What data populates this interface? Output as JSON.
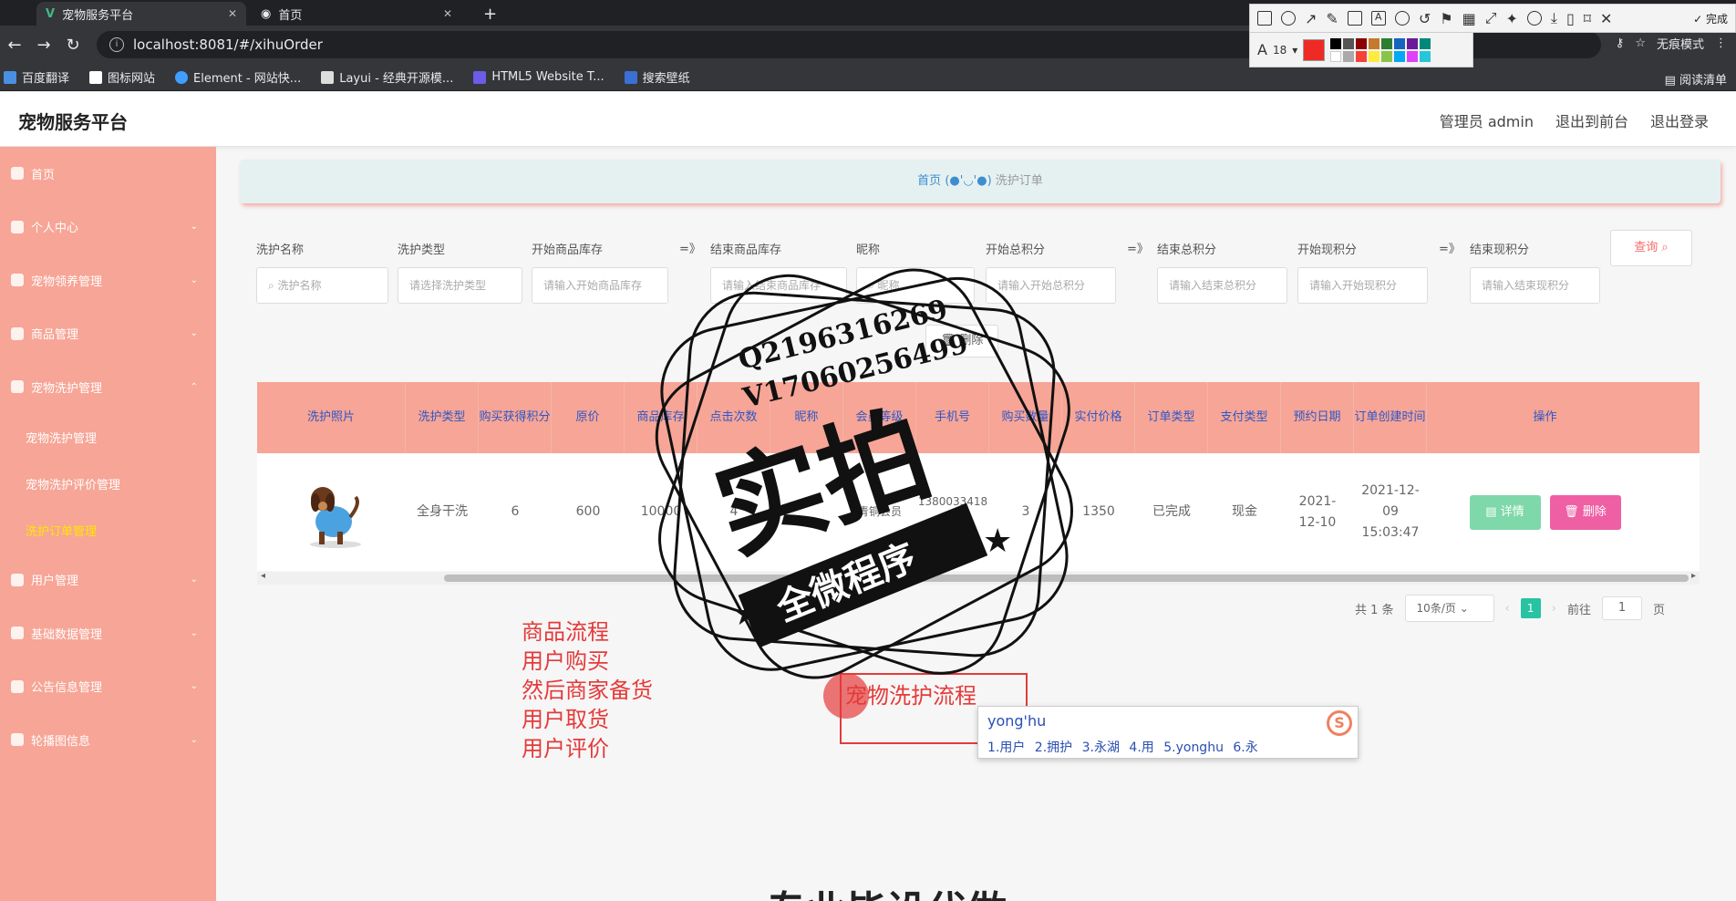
{
  "browser": {
    "tabs": [
      {
        "title": "宠物服务平台",
        "active": true
      },
      {
        "title": "首页",
        "active": false
      }
    ],
    "url": "localhost:8081/#/xihuOrder",
    "bookmarks": [
      "百度翻译",
      "图标网站",
      "Element - 网站快...",
      "Layui - 经典开源模...",
      "HTML5 Website T...",
      "搜索壁纸"
    ],
    "reading_list": "阅读清单",
    "profile": "无痕模式"
  },
  "annotation_toolbar": {
    "done_label": "完成",
    "font_size": "18",
    "active_color": "#ee2a24"
  },
  "header": {
    "title": "宠物服务平台",
    "links": [
      "管理员 admin",
      "退出到前台",
      "退出登录"
    ]
  },
  "sidebar": {
    "items": [
      {
        "label": "首页"
      },
      {
        "label": "个人中心"
      },
      {
        "label": "宠物领养管理"
      },
      {
        "label": "商品管理"
      },
      {
        "label": "宠物洗护管理"
      }
    ],
    "subitems": [
      "宠物洗护管理",
      "宠物洗护评价管理",
      "洗护订单管理"
    ],
    "items_after": [
      {
        "label": "用户管理"
      },
      {
        "label": "基础数据管理"
      },
      {
        "label": "公告信息管理"
      },
      {
        "label": "轮播图信息"
      }
    ]
  },
  "breadcrumb": {
    "home": "首页",
    "face": "(●'◡'●)",
    "current": "洗护订单"
  },
  "filters": {
    "labels": [
      "洗护名称",
      "洗护类型",
      "开始商品库存",
      "结束商品库存",
      "昵称",
      "开始总积分",
      "结束总积分",
      "开始现积分",
      "结束现积分"
    ],
    "placeholders": [
      "洗护名称",
      "请选择洗护类型",
      "请输入开始商品库存",
      "请输入结束商品库存",
      "昵称",
      "请输入开始总积分",
      "请输入结束总积分",
      "请输入开始现积分",
      "请输入结束现积分"
    ],
    "query_label": "查询",
    "delete_label": "删除"
  },
  "table": {
    "columns": [
      "洗护照片",
      "洗护类型",
      "购买获得积分",
      "原价",
      "商品库存",
      "点击次数",
      "昵称",
      "会员等级",
      "手机号",
      "购买数量",
      "实付价格",
      "订单类型",
      "支付类型",
      "预约日期",
      "订单创建时间",
      "操作"
    ],
    "rows": [
      {
        "type": "全身干洗",
        "points": "6",
        "price": "600",
        "stock": "10000",
        "clicks": "4",
        "nickname": "",
        "level": "青铜会员",
        "phone": "13800334181460",
        "qty": "3",
        "paid": "1350",
        "order_type": "已完成",
        "pay_type": "现金",
        "booking_date": "2021-12-10",
        "created": "2021-12-09 15:03:47",
        "detail_label": "详情",
        "delete_label": "删除"
      }
    ]
  },
  "pagination": {
    "total": "共 1 条",
    "page_size": "10条/页",
    "current": "1",
    "goto_prefix": "前往",
    "goto_value": "1",
    "goto_suffix": "页"
  },
  "overlay": {
    "notes": [
      "商品流程",
      "用户购买",
      "然后商家备货",
      "用户取货",
      "用户评价"
    ],
    "box_text": "宠物洗护流程",
    "ime_input": "yong'hu",
    "ime_candidates": "1.用户  2.拥护  3.永湖  4.用  5.yonghu  6.永",
    "bottom_text": "专业毕设代做"
  },
  "stamp": {
    "line1": "Q2196316269",
    "line2": "V17060256499",
    "main": "实拍",
    "banner": "全微程序"
  }
}
